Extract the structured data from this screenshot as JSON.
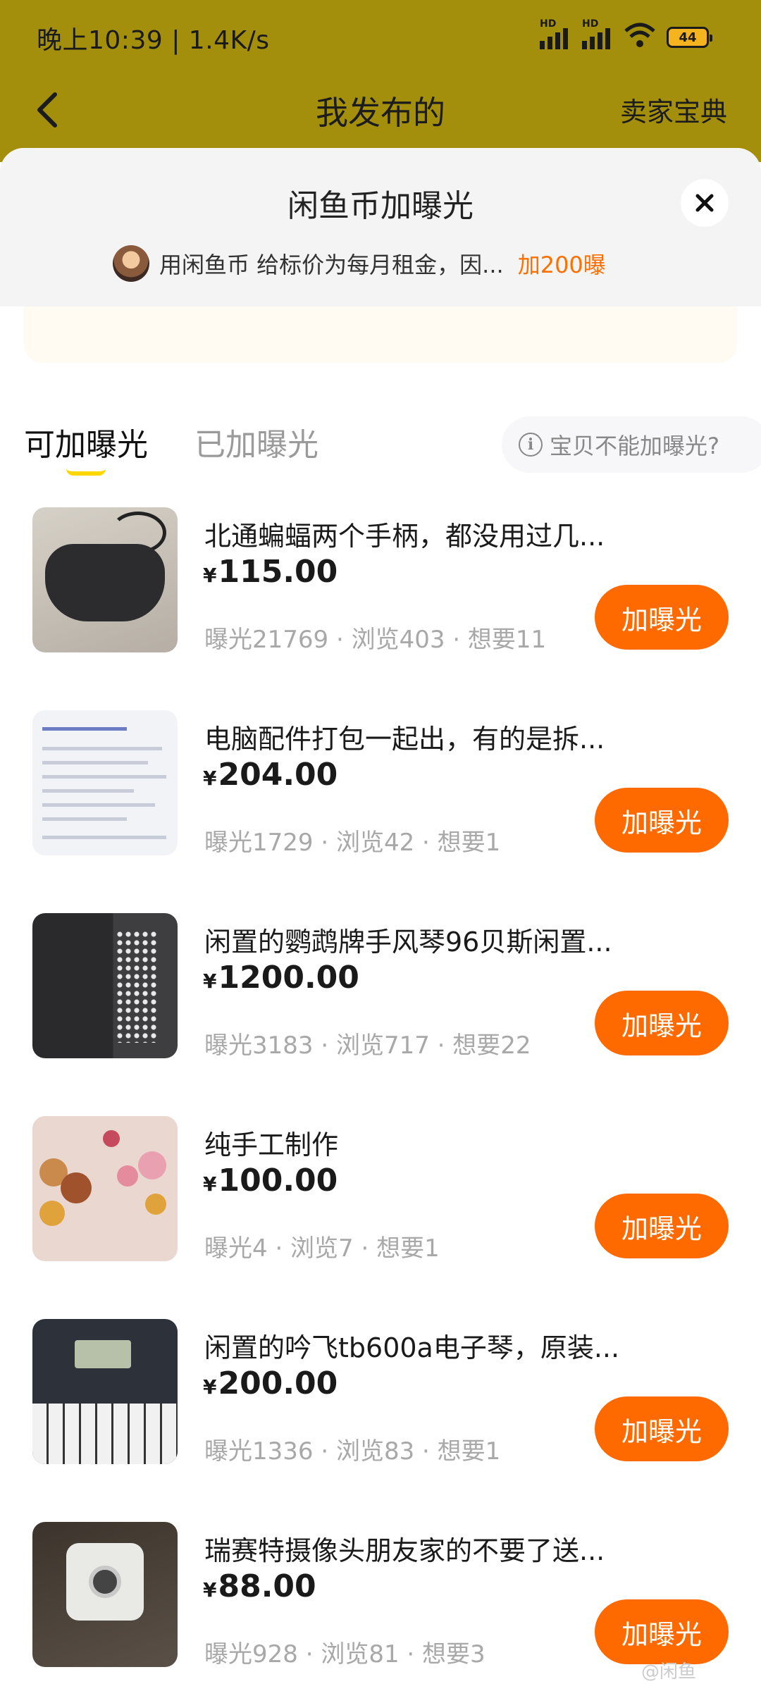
{
  "status_bar": {
    "time": "晚上10:39 | 1.4K/s",
    "hd1": "HD",
    "hd2": "HD",
    "battery": "44"
  },
  "navbar": {
    "title": "我发布的",
    "right_link": "卖家宝典"
  },
  "sheet": {
    "title": "闲鱼币加曝光",
    "ticker_text": "用闲鱼币 给标价为每月租金，因...",
    "ticker_highlight": "加200曝"
  },
  "tabs": [
    {
      "label": "可加曝光",
      "active": true
    },
    {
      "label": "已加曝光",
      "active": false
    }
  ],
  "help_pill": {
    "icon": "info-icon",
    "text": "宝贝不能加曝光?"
  },
  "currency_symbol": "¥",
  "colors": {
    "header_bg": "#a38f0b",
    "accent": "#ff6a00",
    "ticker_highlight": "#ff6f00"
  },
  "items": [
    {
      "title": "北通蝙蝠两个手柄，都没用过几...",
      "price": "115.00",
      "stats": "曝光21769 · 浏览403 · 想要11",
      "button": "加曝光"
    },
    {
      "title": "电脑配件打包一起出，有的是拆...",
      "price": "204.00",
      "stats": "曝光1729 · 浏览42 · 想要1",
      "button": "加曝光"
    },
    {
      "title": "闲置的鹦鹉牌手风琴96贝斯闲置...",
      "price": "1200.00",
      "stats": "曝光3183 · 浏览717 · 想要22",
      "button": "加曝光"
    },
    {
      "title": "纯手工制作",
      "price": "100.00",
      "stats": "曝光4 · 浏览7 · 想要1",
      "button": "加曝光"
    },
    {
      "title": "闲置的吟飞tb600a电子琴，原装...",
      "price": "200.00",
      "stats": "曝光1336 · 浏览83 · 想要1",
      "button": "加曝光"
    },
    {
      "title": "瑞赛特摄像头朋友家的不要了送...",
      "price": "88.00",
      "stats": "曝光928 · 浏览81 · 想要3",
      "button": "加曝光"
    }
  ],
  "watermark": "@闲鱼"
}
